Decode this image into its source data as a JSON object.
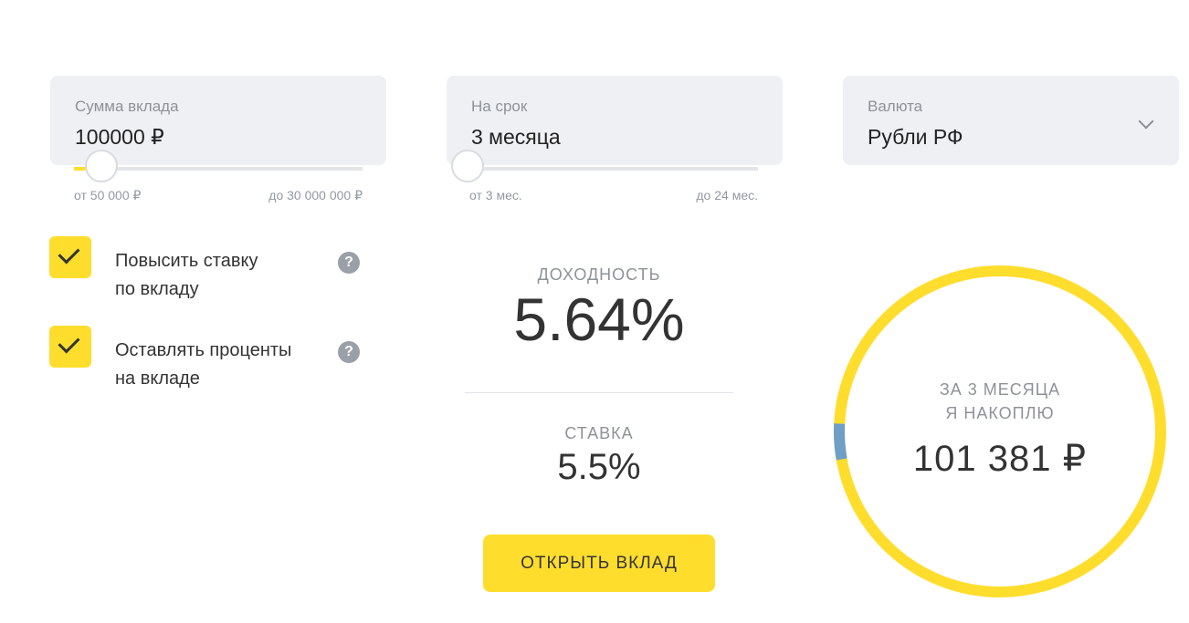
{
  "deposit": {
    "amount": {
      "label": "Сумма вклада",
      "value": "100000 ₽",
      "min_label": "от 50 000 ₽",
      "max_label": "до 30 000 000 ₽",
      "slider_fraction": 0.002
    },
    "term": {
      "label": "На срок",
      "value": "3 месяца",
      "min_label": "от 3 мес.",
      "max_label": "до 24 мес.",
      "slider_fraction": 0.0
    },
    "currency": {
      "label": "Валюта",
      "value": "Рубли РФ",
      "icon": "chevron-down-icon"
    }
  },
  "options": [
    {
      "line1": "Повысить ставку",
      "line2": "по вкладу",
      "checked": true,
      "help": "?"
    },
    {
      "line1": "Оставлять проценты",
      "line2": "на вкладе",
      "checked": true,
      "help": "?"
    }
  ],
  "results": {
    "yield_caption": "ДОХОДНОСТЬ",
    "yield_value": "5.64%",
    "rate_caption": "СТАВКА",
    "rate_value": "5.5%"
  },
  "cta": {
    "label": "ОТКРЫТЬ ВКЛАД"
  },
  "savings": {
    "caption_line1": "ЗА 3 МЕСЯЦА",
    "caption_line2": "Я НАКОПЛЮ",
    "value": "101 381 ₽",
    "interest_share": 0.0136
  },
  "colors": {
    "accent": "#ffdd2d",
    "ring_secondary": "#6f9ec7",
    "field_bg": "#eef0f3",
    "muted_text": "#8e9298"
  }
}
